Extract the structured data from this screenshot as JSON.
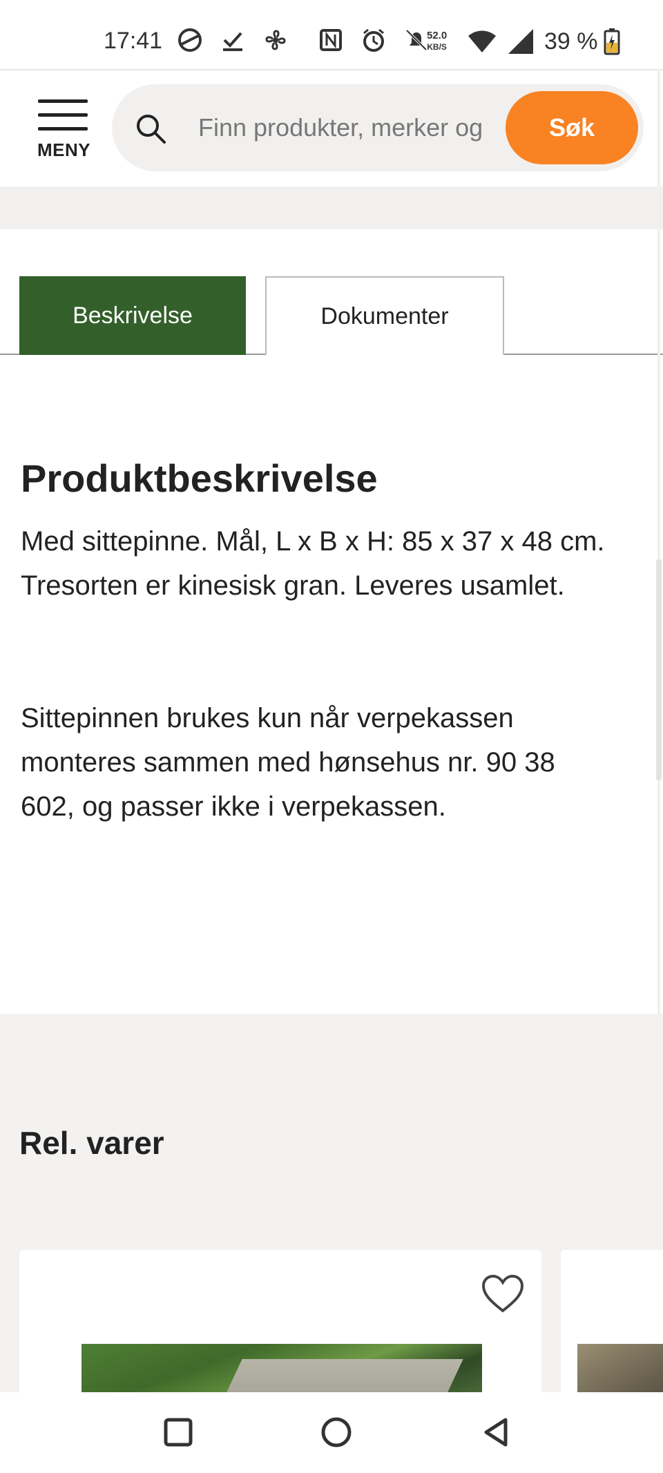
{
  "status": {
    "time": "17:41",
    "net_speed_value": "52.0",
    "net_speed_unit": "KB/S",
    "battery": "39 %"
  },
  "header": {
    "menu_label": "MENY",
    "search_placeholder": "Finn produkter, merker og",
    "search_button": "Søk",
    "accent": "#f98223"
  },
  "tabs": [
    {
      "label": "Beskrivelse",
      "active": true
    },
    {
      "label": "Dokumenter",
      "active": false
    }
  ],
  "tab_active_color": "#33602a",
  "description": {
    "title": "Produktbeskrivelse",
    "paragraph_1": "Med sittepinne. Mål, L x B x H: 85 x 37 x 48 cm. Tresorten er kinesisk gran. Leveres usamlet.",
    "paragraph_2": "Sittepinnen brukes kun når verpekassen monteres sammen med hønsehus nr. 90 38 602, og passer ikke i verpekassen."
  },
  "related": {
    "title": "Rel. varer"
  },
  "icons": {
    "search": "search-icon",
    "menu": "hamburger-icon",
    "favorite": "heart-icon",
    "nav_recent": "square-icon",
    "nav_home": "circle-icon",
    "nav_back": "triangle-back-icon"
  }
}
